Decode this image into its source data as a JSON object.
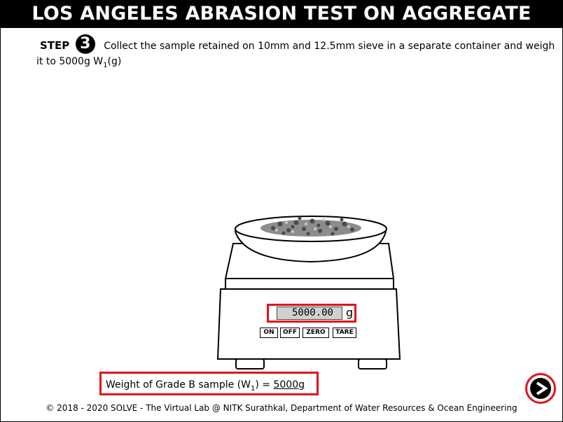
{
  "header": {
    "title": "LOS ANGELES ABRASION TEST ON AGGREGATE"
  },
  "step": {
    "label": "STEP",
    "number": "3",
    "text_part1": "Collect the sample retained on 10mm and 12.5mm sieve in a separate container and weigh",
    "text_part2": "it to 5000g W",
    "text_sub": "1",
    "text_part3": "(g)"
  },
  "scale": {
    "display_value": "5000.00",
    "unit": "g",
    "buttons": {
      "on": "ON",
      "off": "OFF",
      "zero": "ZERO",
      "tare": "TARE"
    }
  },
  "result": {
    "label": "Weight of Grade B sample (W",
    "label_sub": "1",
    "label_end": ") = ",
    "value": "5000g"
  },
  "footer": {
    "text": "© 2018 - 2020 SOLVE - The Virtual Lab @ NITK Surathkal, Department of Water Resources & Ocean Engineering"
  },
  "nav": {
    "next_icon": "chevron-right-icon"
  },
  "colors": {
    "highlight": "#e0141e",
    "title_bg": "#000000"
  }
}
